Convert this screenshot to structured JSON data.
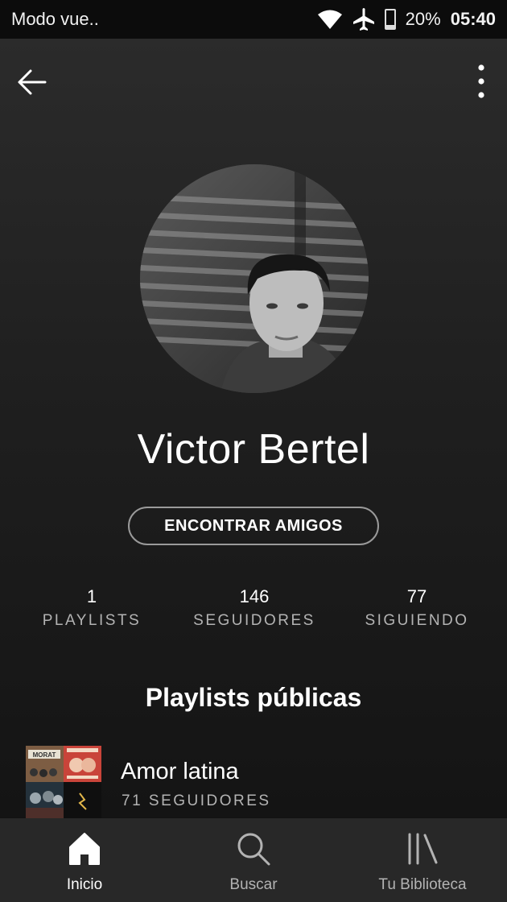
{
  "status_bar": {
    "carrier": "Modo vue..",
    "battery": "20%",
    "battery_level": 0.2,
    "time": "05:40",
    "icons": [
      "wifi-icon",
      "airplane-icon",
      "battery-icon"
    ]
  },
  "header": {
    "back_icon": "arrow-left-icon",
    "more_icon": "more-vertical-icon"
  },
  "profile": {
    "name": "Victor Bertel",
    "find_friends_label": "ENCONTRAR AMIGOS",
    "stats": [
      {
        "value": "1",
        "label": "PLAYLISTS"
      },
      {
        "value": "146",
        "label": "SEGUIDORES"
      },
      {
        "value": "77",
        "label": "SIGUIENDO"
      }
    ]
  },
  "playlists": {
    "section_title": "Playlists públicas",
    "items": [
      {
        "name": "Amor latina",
        "followers": "71 SEGUIDORES",
        "cover_text": "MORAT"
      }
    ]
  },
  "nav": {
    "items": [
      {
        "label": "Inicio",
        "icon": "home-icon",
        "active": true
      },
      {
        "label": "Buscar",
        "icon": "search-icon",
        "active": false
      },
      {
        "label": "Tu Biblioteca",
        "icon": "library-icon",
        "active": false
      }
    ]
  },
  "colors": {
    "background": "#121212",
    "nav_background": "#282828",
    "secondary_text": "#b3b3b3"
  }
}
